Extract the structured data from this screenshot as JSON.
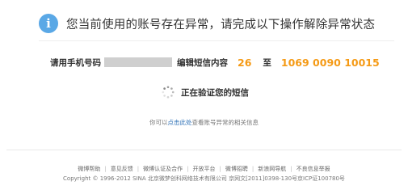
{
  "header": {
    "icon": "info-icon",
    "icon_glyph": "i",
    "title": "您当前使用的账号存在异常，请完成以下操作解除异常状态"
  },
  "sms": {
    "phone_label": "请用手机号码",
    "content_label": "编辑短信内容",
    "code": "26",
    "to_label": "至",
    "target_number": "1069 0090 10015"
  },
  "verify": {
    "icon": "loading-spinner-icon",
    "text": "正在验证您的短信"
  },
  "help": {
    "prefix": "你可以",
    "link": "点击此处",
    "suffix": "查看账号异常的相关信息"
  },
  "footer": {
    "links": [
      "微博帮助",
      "意见反馈",
      "微博认证及合作",
      "开放平台",
      "微博招聘",
      "新浪网导航",
      "不良信息举报"
    ],
    "copyright": "Copyright © 1996-2012 SINA 北京微梦创科网络技术有限公司  京网文[2011]0398-130号京ICP证100780号"
  },
  "colors": {
    "accent_orange": "#f59a15",
    "link_blue": "#2b6fb6",
    "info_blue": "#5aa8e6"
  }
}
